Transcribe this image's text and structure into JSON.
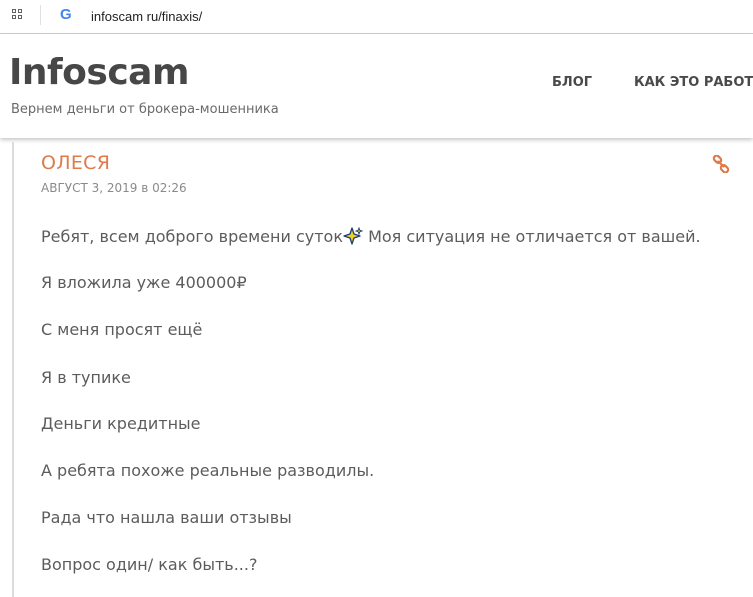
{
  "browser": {
    "url": "infoscam ru/finaxis/"
  },
  "header": {
    "title": "Infoscam",
    "tagline": "Вернем деньги от брокера-мошенника",
    "nav": [
      {
        "label": "БЛОГ"
      },
      {
        "label": "КАК ЭТО РАБОТА"
      }
    ]
  },
  "comment": {
    "author": "ОЛЕСЯ",
    "date": "АВГУСТ 3, 2019 в 02:26",
    "first_line_before": "Ребят, всем доброго времени суток",
    "first_line_after": " Моя ситуация не отличается от вашей.",
    "lines": [
      "Я вложила уже 400000₽",
      "С меня просят ещё",
      "Я в тупике",
      "Деньги кредитные",
      "А ребята похоже реальные разводилы.",
      "Рада что нашла ваши отзывы",
      "Вопрос один/ как быть...?"
    ]
  },
  "colors": {
    "accent": "#e07a48",
    "text": "#5c5c5c",
    "title": "#474747"
  },
  "icons": {
    "apps": "apps-grid-icon",
    "favicon": "google-g-icon",
    "permalink": "link-icon",
    "emoji": "sparkles-icon"
  }
}
